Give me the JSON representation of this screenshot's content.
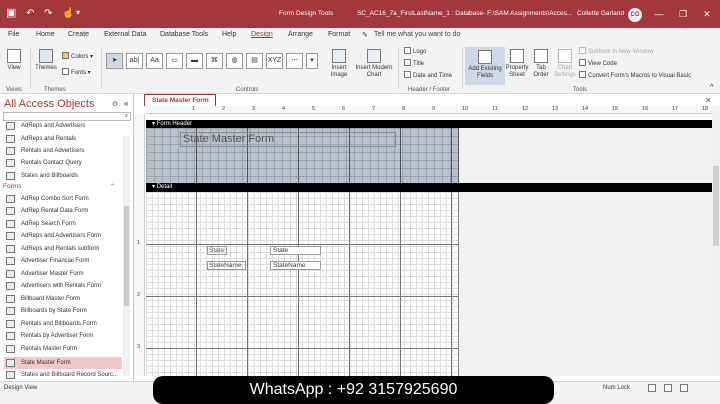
{
  "titlebar": {
    "tools_context": "Form Design Tools",
    "doc_title": "SC_AC16_7a_FirstLastName_1 : Database- F:\\SAM Assignments\\Acces...",
    "user_name": "Collette Garland",
    "user_initials": "CG",
    "color": "#a4373a"
  },
  "menu": {
    "tabs": [
      "File",
      "Home",
      "Create",
      "External Data",
      "Database Tools",
      "Help",
      "Design",
      "Arrange",
      "Format"
    ],
    "active_tab": "Design",
    "tell_me": "Tell me what you want to do"
  },
  "ribbon": {
    "view_label": "View",
    "views_group": "Views",
    "themes_label": "Themes",
    "colors_label": "Colors",
    "fonts_label": "Fonts",
    "themes_group": "Themes",
    "controls_group": "Controls",
    "insert_image": "Insert Image",
    "insert_modern_chart": "Insert Modern Chart",
    "logo": "Logo",
    "title": "Title",
    "date_time": "Date and Time",
    "header_footer_group": "Header / Footer",
    "add_existing_fields": "Add Existing Fields",
    "property_sheet": "Property Sheet",
    "tab_order": "Tab Order",
    "chart_settings": "Chart Settings",
    "subform_new_window": "Subform in New Window",
    "view_code": "View Code",
    "convert_macros": "Convert Form's Macros to Visual Basic",
    "tools_group": "Tools"
  },
  "nav": {
    "title": "All Access Objects",
    "search_placeholder": "Search...",
    "queries": [
      "AdReps and Advertisers",
      "AdReps and Rentals",
      "Rentals and Advertisers",
      "Rentals Contact Query",
      "States and Billboards"
    ],
    "forms_header": "Forms",
    "forms": [
      "AdRep Combo Sort Form",
      "AdRep Rental Data Form",
      "AdRep Search Form",
      "AdReps and Advertisers Form",
      "AdReps and Rentals subform",
      "Advertiser Financial Form",
      "Advertiser Master Form",
      "Advertisers with Rentals Form",
      "Billboard Master Form",
      "Billboards by State Form",
      "Rentals and Billboards Form",
      "Rentals by Advertiser Form",
      "Rentals Master Form",
      "State Master Form",
      "States and Billboard Record Sourc..."
    ],
    "selected_form": "State Master Form"
  },
  "document": {
    "tab_label": "State Master Form",
    "form_header_label": "Form Header",
    "detail_label": "Detail",
    "title_text": "State Master Form",
    "controls": [
      {
        "label": "State",
        "textbox": "State"
      },
      {
        "label": "StateName",
        "textbox": "StateName"
      }
    ],
    "ruler_h": [
      "1",
      "2",
      "3",
      "4",
      "5",
      "6",
      "7",
      "8",
      "9",
      "10",
      "11",
      "12",
      "13",
      "14",
      "15",
      "16",
      "17",
      "18"
    ],
    "ruler_v": [
      "1",
      "2",
      "3"
    ]
  },
  "status": {
    "view": "Design View",
    "num_lock": "Num Lock"
  },
  "watermark": "WhatsApp : +92 3157925690"
}
